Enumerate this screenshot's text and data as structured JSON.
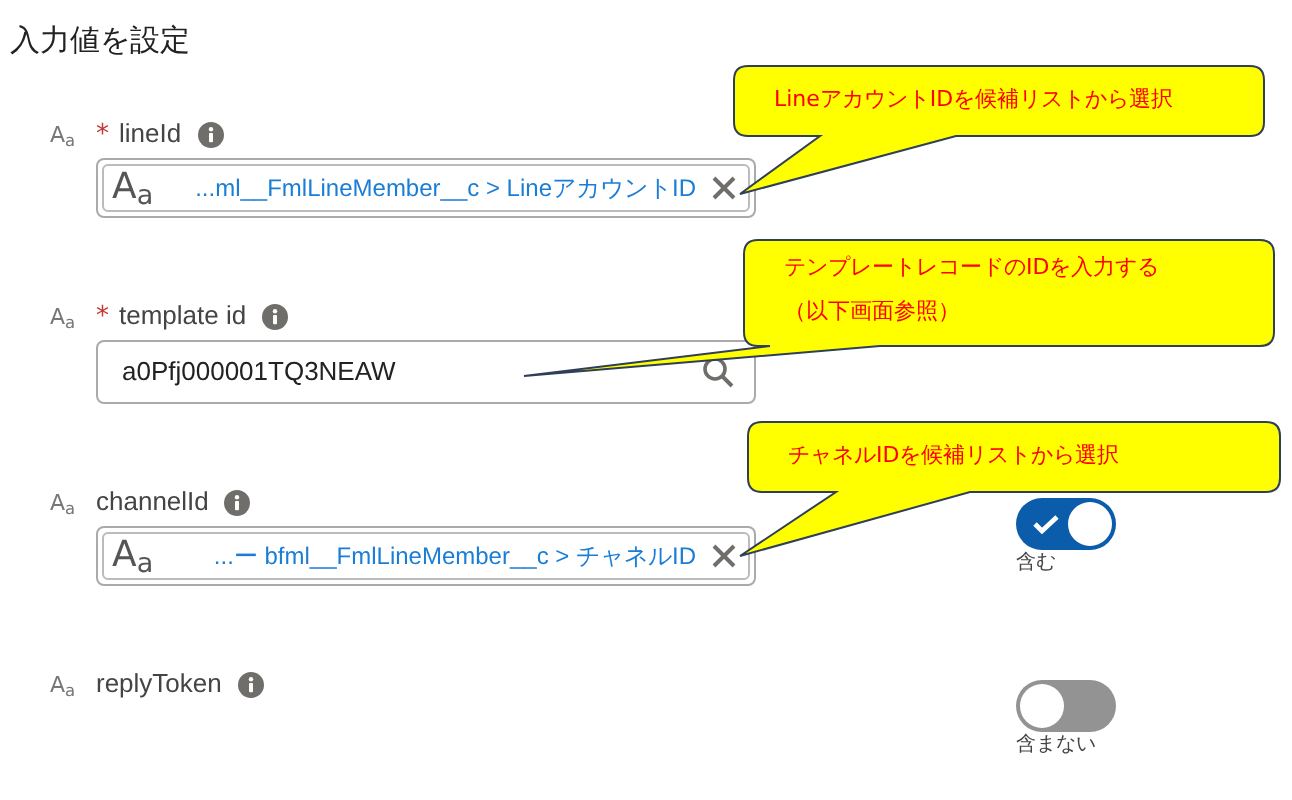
{
  "title": "入力値を設定",
  "fields": [
    {
      "kind": "lookup",
      "type_badge": "A$_{a}$",
      "required_mark": "*",
      "label": "lineId",
      "value_badge": "A$_{a}$",
      "value": "...ml__FmlLineMember__c > LineアカウントID"
    },
    {
      "kind": "search",
      "type_badge": "A$_{a}$",
      "required_mark": "*",
      "label": "template id",
      "value": "a0Pfj000001TQ3NEAW"
    },
    {
      "kind": "lookup",
      "type_badge": "A$_{a}$",
      "label": "channelId",
      "value_badge": "A$_{a}$",
      "value": "...ー bfml__FmlLineMember__c > チャネルID",
      "toggle": {
        "on": true,
        "label": "含む"
      }
    },
    {
      "kind": "empty",
      "type_badge": "A$_{a}$",
      "label": "replyToken",
      "toggle": {
        "on": false,
        "label": "含まない"
      }
    }
  ],
  "callouts": [
    {
      "lines": [
        "LineアカウントIDを候補リストから選択"
      ]
    },
    {
      "lines": [
        "テンプレートレコードのIDを入力する",
        "（以下画面参照）"
      ]
    },
    {
      "lines": [
        "チャネルIDを候補リストから選択"
      ]
    }
  ]
}
